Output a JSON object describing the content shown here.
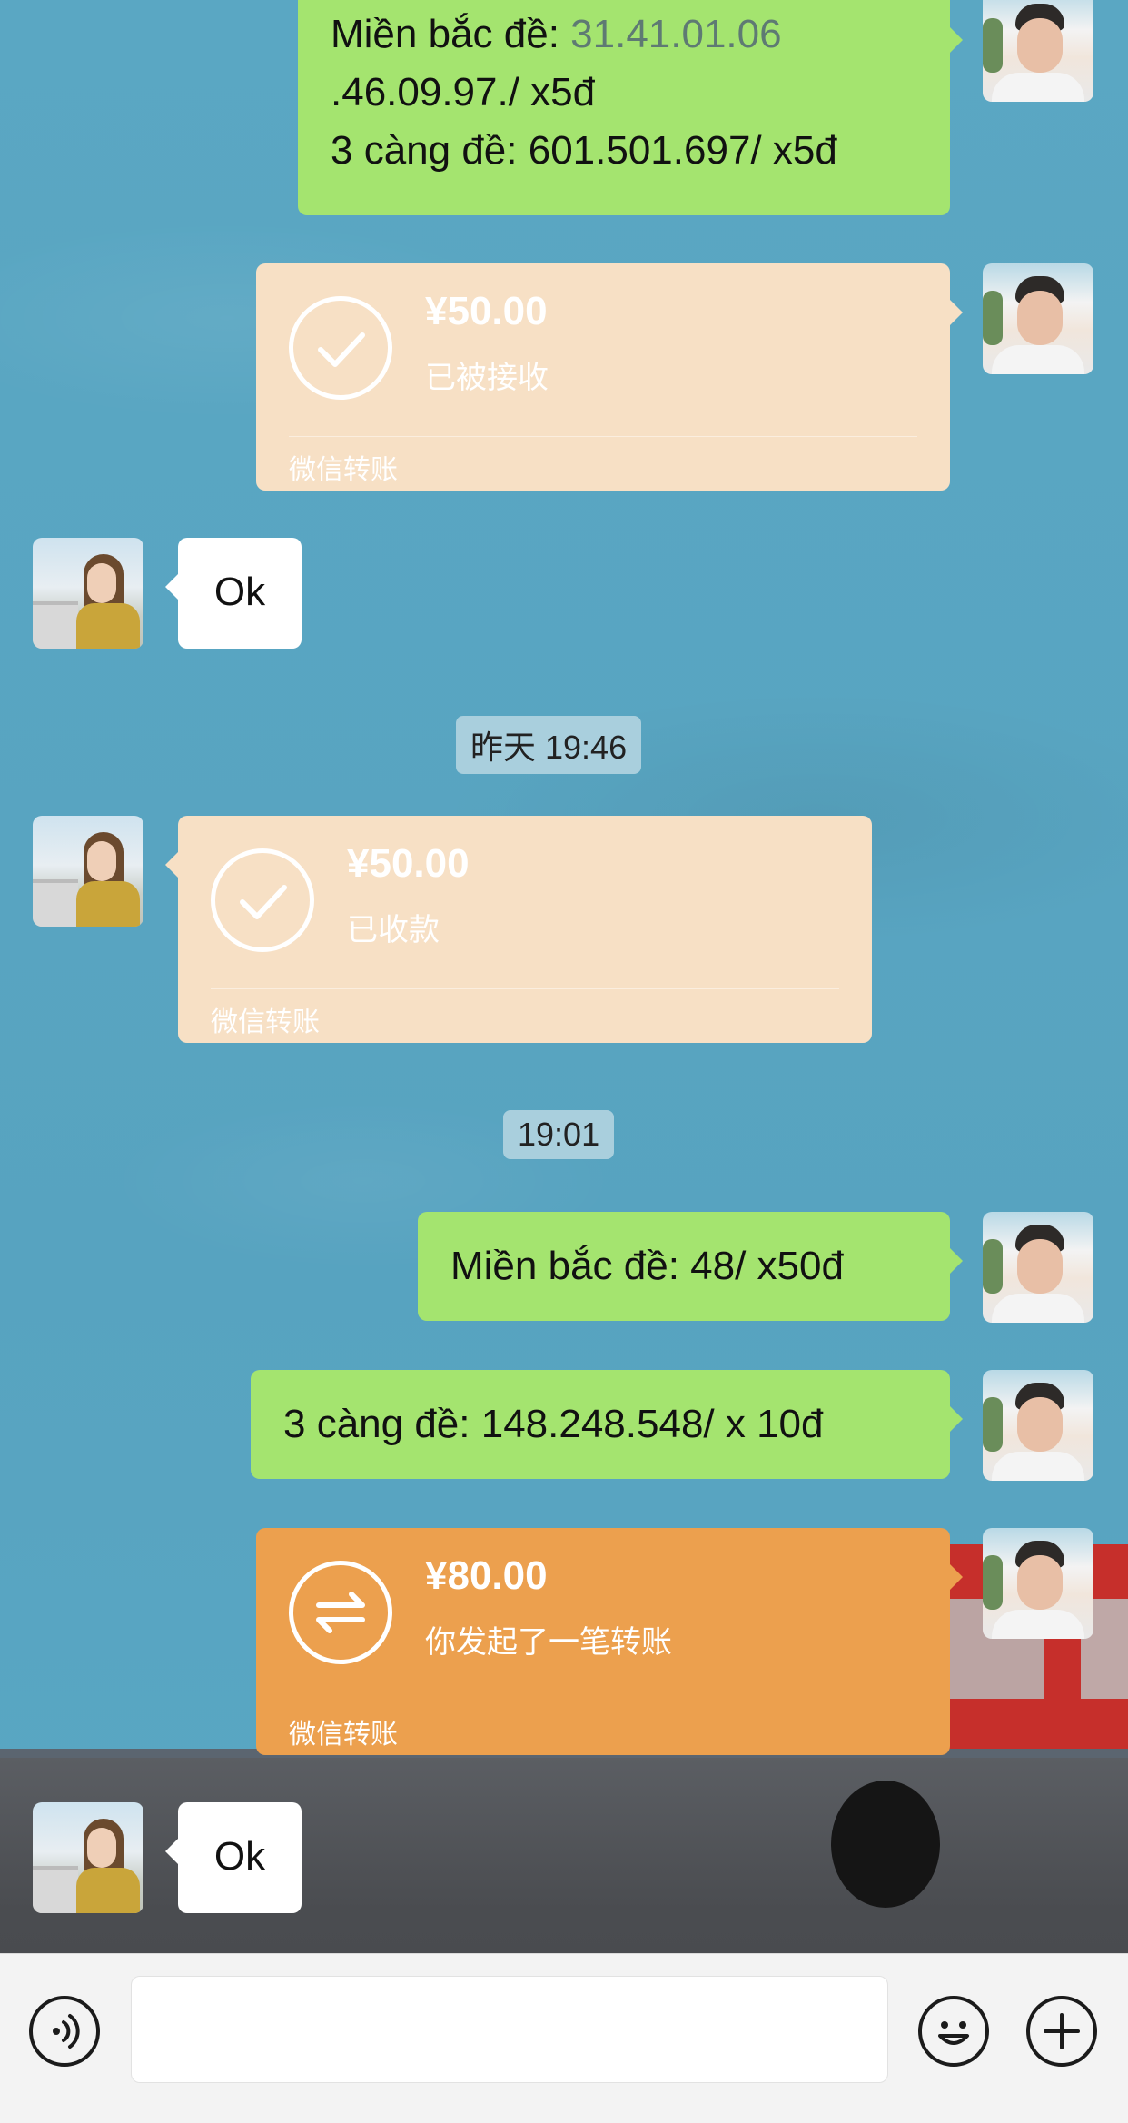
{
  "messages": {
    "m1": {
      "line1_prefix": "Miền bắc đề: ",
      "line1_link": "31.41.01.06",
      "line2": ".46.09.97./ x5đ",
      "line3": "3 càng đề: 601.501.697/ x5đ"
    },
    "transfer1": {
      "amount": "¥50.00",
      "status": "已被接收",
      "label": "微信转账"
    },
    "reply1": "Ok",
    "time1": "昨天 19:46",
    "transfer2": {
      "amount": "¥50.00",
      "status": "已收款",
      "label": "微信转账"
    },
    "time2": "19:01",
    "m2": "Miền bắc đề: 48/ x50đ",
    "m3": "3 càng đề: 148.248.548/ x 10đ",
    "transfer3": {
      "amount": "¥80.00",
      "status": "你发起了一笔转账",
      "label": "微信转账"
    },
    "reply2": "Ok"
  },
  "icons": {
    "check": "check-circle-icon",
    "transfer": "transfer-arrows-icon",
    "voice": "voice-icon",
    "emoji": "emoji-icon",
    "plus": "plus-icon"
  },
  "colors": {
    "sent_bubble": "#a4e46f",
    "received_bubble": "#ffffff",
    "transfer_done": "#f7e0c5",
    "transfer_pending": "#eca04e",
    "chat_background": "#5aa6c2"
  }
}
